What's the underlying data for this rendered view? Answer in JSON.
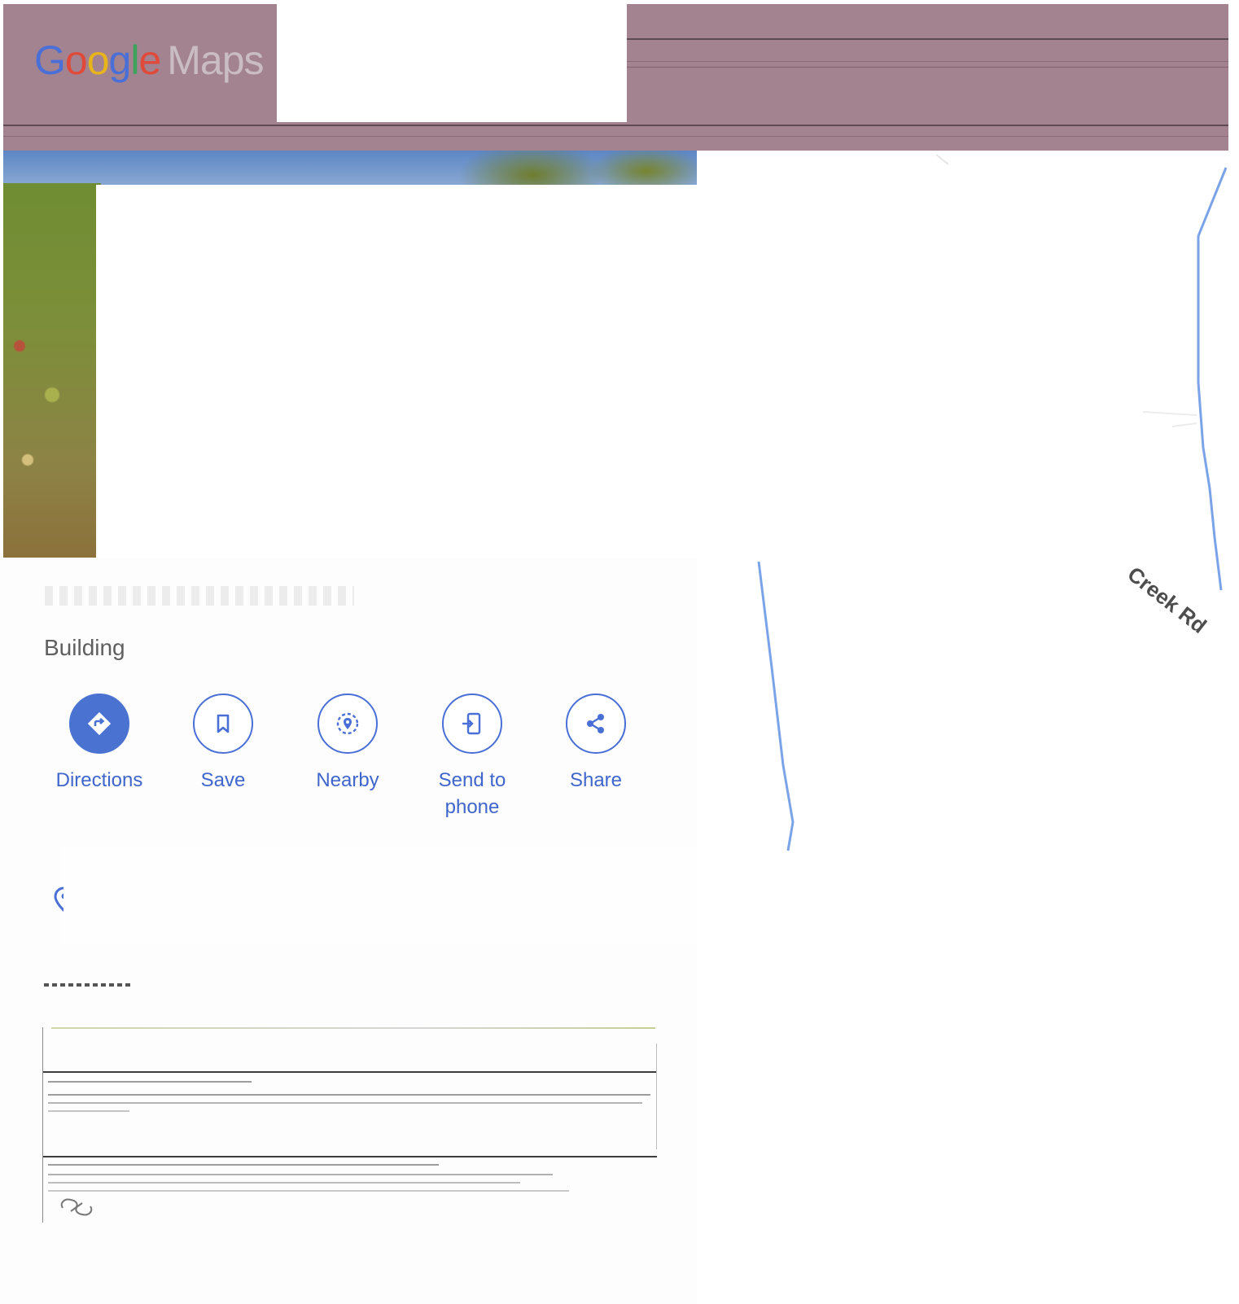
{
  "header": {
    "logo_brand": "Google",
    "logo_product": "Maps"
  },
  "place": {
    "category": "Building"
  },
  "actions": [
    {
      "label": "Directions",
      "icon": "directions-icon"
    },
    {
      "label": "Save",
      "icon": "bookmark-icon"
    },
    {
      "label": "Nearby",
      "icon": "nearby-icon"
    },
    {
      "label": "Send to\nphone",
      "icon": "send-to-phone-icon"
    },
    {
      "label": "Share",
      "icon": "share-icon"
    }
  ],
  "map": {
    "road_label": "Creek Rd",
    "road_color": "#7aa3e8"
  },
  "colors": {
    "header": "#a2838f",
    "accent": "#4a72d1",
    "action_text": "#3f66cc"
  }
}
